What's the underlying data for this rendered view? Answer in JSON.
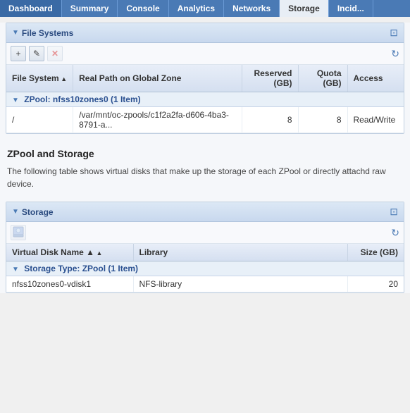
{
  "tabs": [
    {
      "id": "dashboard",
      "label": "Dashboard",
      "active": false
    },
    {
      "id": "summary",
      "label": "Summary",
      "active": false
    },
    {
      "id": "console",
      "label": "Console",
      "active": false
    },
    {
      "id": "analytics",
      "label": "Analytics",
      "active": false
    },
    {
      "id": "networks",
      "label": "Networks",
      "active": false
    },
    {
      "id": "storage",
      "label": "Storage",
      "active": true
    },
    {
      "id": "incidents",
      "label": "Incid...",
      "active": false
    }
  ],
  "filesystems_panel": {
    "title": "File Systems",
    "toolbar": {
      "add_label": "+",
      "edit_label": "✎",
      "delete_label": "✕",
      "refresh_label": "↻"
    },
    "table": {
      "columns": [
        {
          "id": "filesystem",
          "label": "File System",
          "sort": "asc"
        },
        {
          "id": "realpath",
          "label": "Real Path on Global Zone"
        },
        {
          "id": "reserved",
          "label": "Reserved\n(GB)",
          "align": "right"
        },
        {
          "id": "quota",
          "label": "Quota\n(GB)",
          "align": "right"
        },
        {
          "id": "access",
          "label": "Access"
        }
      ],
      "groups": [
        {
          "label": "ZPool: nfss10zones0 (1 Item)",
          "rows": [
            {
              "filesystem": "/",
              "realpath": "/var/mnt/oc-zpools/c1f2a2fa-d606-4ba3-8791-a...",
              "reserved": "8",
              "quota": "8",
              "access": "Read/Write"
            }
          ]
        }
      ]
    }
  },
  "description": {
    "title": "ZPool and Storage",
    "text": "The following table shows virtual disks that make up the storage of each ZPool or directly attachd raw device."
  },
  "storage_panel": {
    "title": "Storage",
    "toolbar": {
      "add_label": "⊞",
      "refresh_label": "↻"
    },
    "table": {
      "columns": [
        {
          "id": "vdiskname",
          "label": "Virtual Disk Name",
          "sort": "asc"
        },
        {
          "id": "library",
          "label": "Library"
        },
        {
          "id": "size",
          "label": "Size (GB)",
          "align": "right"
        }
      ],
      "groups": [
        {
          "label": "Storage Type: ZPool (1 Item)",
          "rows": [
            {
              "vdiskname": "nfss10zones0-vdisk1",
              "library": "NFS-library",
              "size": "20"
            }
          ]
        }
      ]
    }
  }
}
